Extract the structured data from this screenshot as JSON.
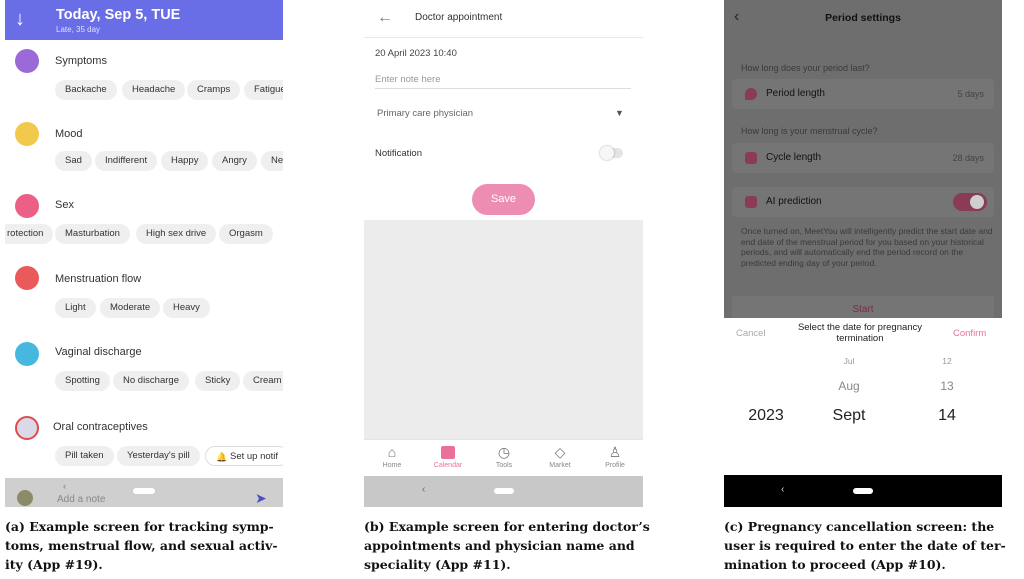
{
  "panel_a": {
    "header": {
      "date": "Today, Sep 5, TUE",
      "sub": "Late, 35 day"
    },
    "sections": [
      {
        "title": "Symptoms",
        "chips": [
          "Backache",
          "Headache",
          "Cramps",
          "Fatigue"
        ]
      },
      {
        "title": "Mood",
        "chips": [
          "Sad",
          "Indifferent",
          "Happy",
          "Angry",
          "Ne"
        ]
      },
      {
        "title": "Sex",
        "chips": [
          "rotection",
          "Masturbation",
          "High sex drive",
          "Orgasm"
        ]
      },
      {
        "title": "Menstruation flow",
        "chips": [
          "Light",
          "Moderate",
          "Heavy"
        ]
      },
      {
        "title": "Vaginal discharge",
        "chips": [
          "Spotting",
          "No discharge",
          "Sticky",
          "Cream"
        ]
      },
      {
        "title": "Oral contraceptives",
        "chips": [
          "Pill taken",
          "Yesterday's pill",
          "Set up notif"
        ]
      }
    ],
    "bottom": {
      "note_placeholder": "Add a note"
    }
  },
  "panel_b": {
    "title": "Doctor appointment",
    "datetime": "20 April 2023 10:40",
    "note_placeholder": "Enter note here",
    "physician": "Primary care physician",
    "notification_label": "Notification",
    "save_label": "Save",
    "nav": [
      "Home",
      "Calendar",
      "Tools",
      "Market",
      "Profile"
    ]
  },
  "panel_c": {
    "title": "Period settings",
    "q1": "How long does your period last?",
    "period_label": "Period length",
    "period_value": "5 days",
    "q2": "How long is your menstrual cycle?",
    "cycle_label": "Cycle length",
    "cycle_value": "28 days",
    "ai_label": "AI prediction",
    "ai_description": "Once turned on, MeetYou will intelligently predict the start date and end date of the menstrual period for you based on your historical periods, and will automatically end the period record on the predicted ending day of your period.",
    "start_label": "Start",
    "sheet": {
      "cancel": "Cancel",
      "title": "Select the date for pregnancy termination",
      "confirm": "Confirm",
      "year": "2023",
      "months": [
        "Jul",
        "Aug",
        "Sept"
      ],
      "days": [
        "12",
        "13",
        "14"
      ]
    }
  },
  "captions": {
    "a": "(a) Example screen for tracking symp-toms, menstrual flow, and sexual activ-ity (App #19).",
    "b": "(b) Example screen for entering doctor’s appointments and physician name and speciality (App #11).",
    "c": "(c) Pregnancy cancellation screen: the user is required to enter the date of ter-mination to proceed (App #10)."
  },
  "colors": {
    "accent_a": "#6a6ee6",
    "accent_pink": "#ec6f9b",
    "save_pink": "#ec8db1"
  },
  "icons": [
    "arrow-down-icon",
    "back-arrow-icon",
    "send-icon",
    "dropdown-caret-icon",
    "home-icon",
    "calendar-icon",
    "tools-icon",
    "market-icon",
    "profile-icon",
    "drop-icon",
    "cycle-icon",
    "ai-icon"
  ]
}
